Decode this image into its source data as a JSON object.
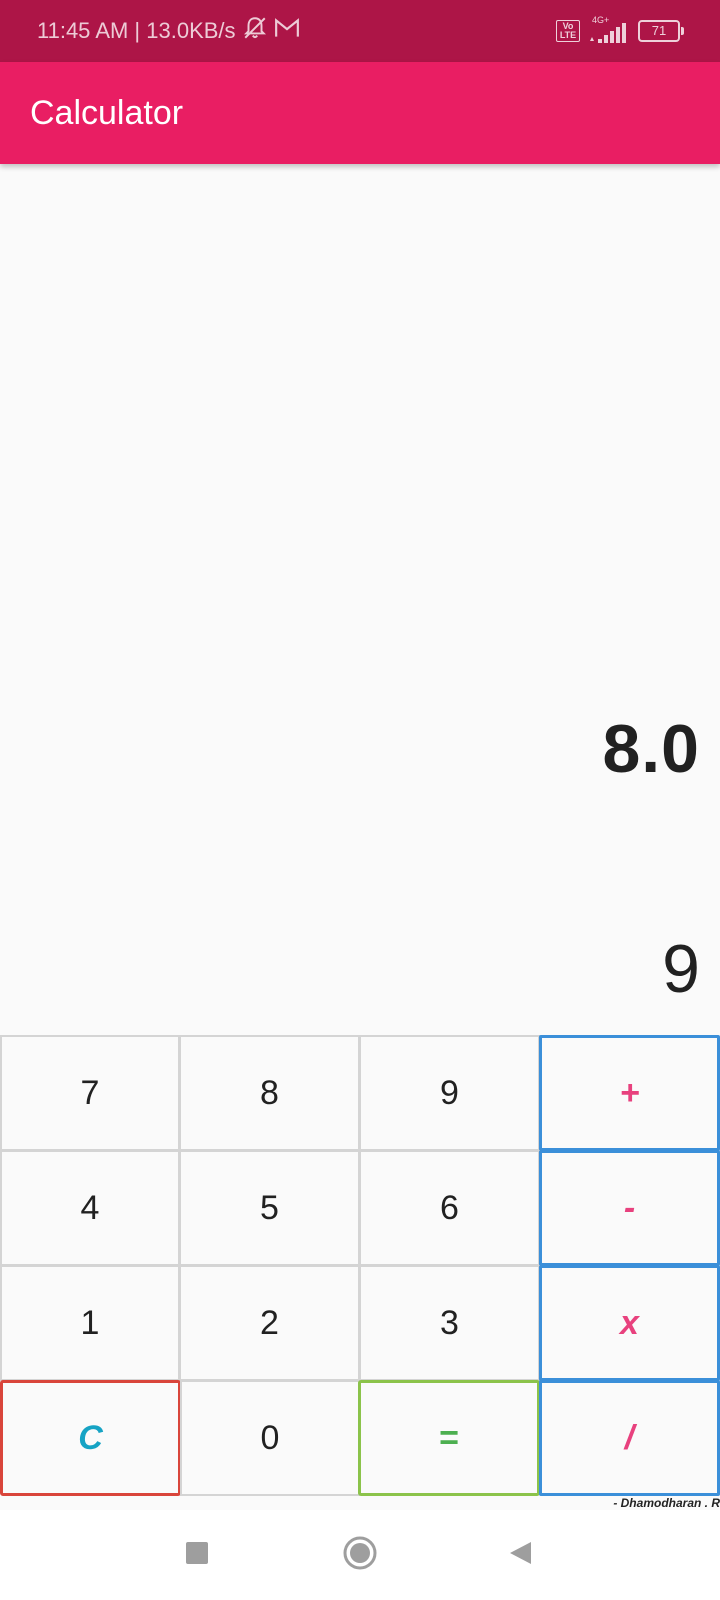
{
  "status_bar": {
    "time_and_speed": "11:45 AM | 13.0KB/s",
    "volte": "Vo LTE",
    "network_type": "4G+",
    "battery_level": "71",
    "icons": [
      "notifications-muted-icon",
      "gmail-icon",
      "volte-icon",
      "signal-icon",
      "battery-icon"
    ]
  },
  "app_bar": {
    "title": "Calculator",
    "color": "#e91e63"
  },
  "display": {
    "result": "8.0",
    "input": "9"
  },
  "keypad": {
    "rows": [
      [
        "7",
        "8",
        "9",
        "+"
      ],
      [
        "4",
        "5",
        "6",
        "-"
      ],
      [
        "1",
        "2",
        "3",
        "x"
      ],
      [
        "C",
        "0",
        "=",
        "/"
      ]
    ],
    "colors": {
      "operator_border": "#3b8fd9",
      "operator_text": "#e8417e",
      "clear_border": "#d9453b",
      "clear_text": "#16a3c4",
      "equals_border": "#8bc34a",
      "equals_text": "#4caf50"
    }
  },
  "credit": "-  Dhamodharan . R",
  "nav_bar": {
    "icons": [
      "recents-square-icon",
      "home-circle-icon",
      "back-triangle-icon"
    ]
  }
}
